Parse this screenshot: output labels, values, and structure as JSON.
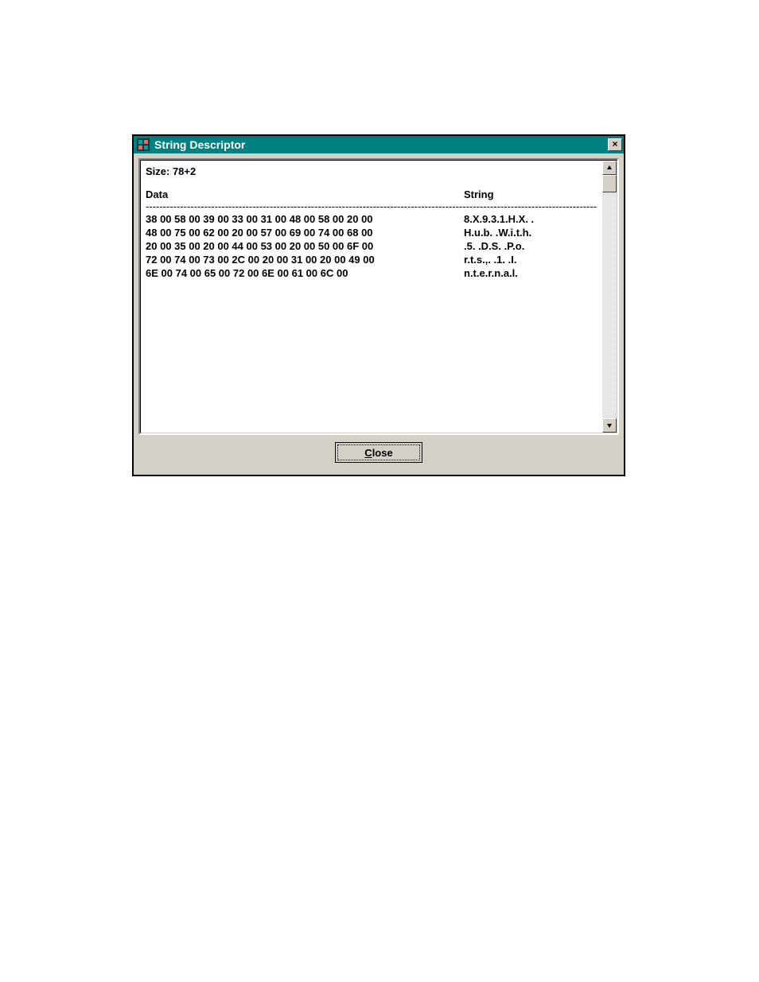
{
  "window": {
    "title": "String Descriptor",
    "close_glyph": "×"
  },
  "content": {
    "size_label": "Size: 78+2",
    "data_header": "Data",
    "string_header": "String",
    "divider": "------------------------------------------------------------------------------------------------------------------------------------",
    "rows": [
      {
        "data": "38 00 58 00 39 00 33 00 31 00 48 00 58 00 20 00",
        "str": "8.X.9.3.1.H.X. ."
      },
      {
        "data": "48 00 75 00 62 00 20 00 57 00 69 00 74 00 68 00",
        "str": "H.u.b. .W.i.t.h."
      },
      {
        "data": "20 00 35 00 20 00 44 00 53 00 20 00 50 00 6F 00",
        "str": " .5. .D.S. .P.o."
      },
      {
        "data": "72 00 74 00 73 00 2C 00 20 00 31 00 20 00 49 00",
        "str": "r.t.s.,. .1. .I."
      },
      {
        "data": "6E 00 74 00 65 00 72 00 6E 00 61 00 6C 00",
        "str": "n.t.e.r.n.a.l."
      }
    ]
  },
  "buttons": {
    "close_mnemonic": "C",
    "close_rest": "lose"
  }
}
